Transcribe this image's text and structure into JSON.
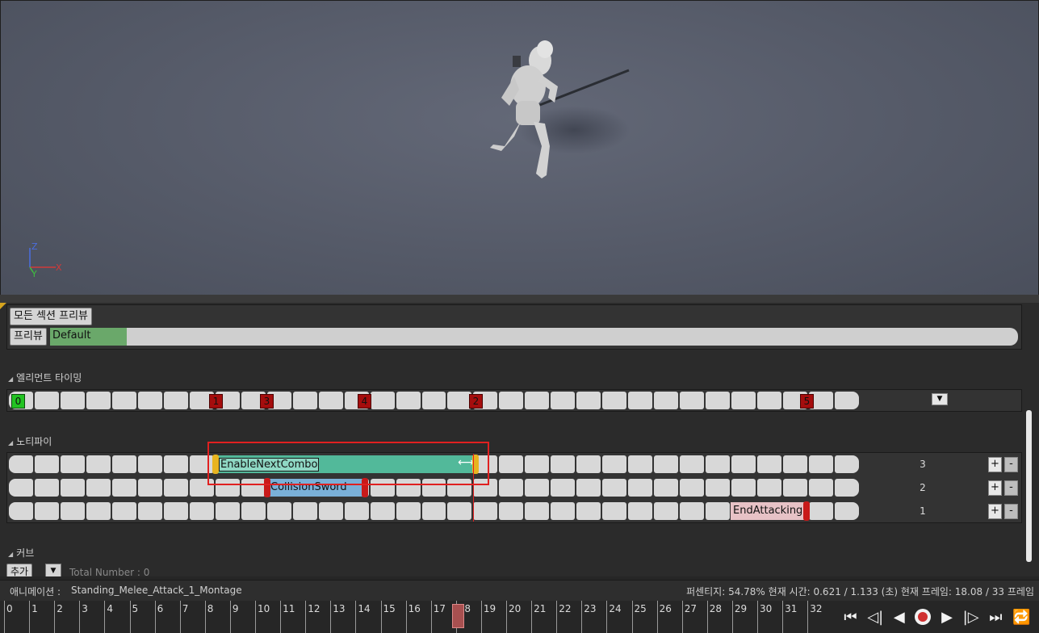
{
  "viewport": {
    "axis_labels": {
      "z": "Z",
      "x": "X",
      "y": "Y"
    }
  },
  "sections": {
    "preview_all_button": "모든 섹션 프리뷰",
    "preview_button": "프리뷰",
    "default_section_label": "Default"
  },
  "element_timing": {
    "header": "엘리먼트 타이밍",
    "markers": [
      "0",
      "1",
      "3",
      "4",
      "2",
      "5"
    ]
  },
  "notifies": {
    "header": "노티파이",
    "tracks": [
      {
        "number": "3",
        "notify_label": "EnableNextCombo"
      },
      {
        "number": "2",
        "notify_label": "CollisionSword"
      },
      {
        "number": "1",
        "notify_label": "EndAttacking"
      }
    ],
    "plus_label": "+",
    "minus_label": "-"
  },
  "curves": {
    "header": "커브",
    "add_button": "추가",
    "total_label": "Total Number : 0"
  },
  "status": {
    "animation_label": "애니메이션 :",
    "animation_name": "Standing_Melee_Attack_1_Montage",
    "percentage_text": "퍼센티지:  54.78% 현재 시간:  0.621 / 1.133 (초) 현재 프레임:  18.08 / 33 프레임"
  },
  "timeline": {
    "ticks": [
      "0",
      "1",
      "2",
      "3",
      "4",
      "5",
      "6",
      "7",
      "8",
      "9",
      "10",
      "11",
      "12",
      "13",
      "14",
      "15",
      "16",
      "17",
      "18",
      "19",
      "20",
      "21",
      "22",
      "23",
      "24",
      "25",
      "26",
      "27",
      "28",
      "29",
      "30",
      "31",
      "32"
    ],
    "current_frame": 18.08,
    "total_frames": 33
  },
  "colors": {
    "notify_enable": "#52b99a",
    "notify_collision": "#7ab0d8",
    "notify_end": "#e7c2c6",
    "marker_red": "#a50d0d",
    "marker_green": "#22c322",
    "highlight": "#e02020"
  },
  "playback": {
    "icons": [
      "to-start-icon",
      "step-back-icon",
      "play-reverse-icon",
      "record-icon",
      "play-icon",
      "step-forward-icon",
      "to-end-icon",
      "loop-icon"
    ]
  }
}
